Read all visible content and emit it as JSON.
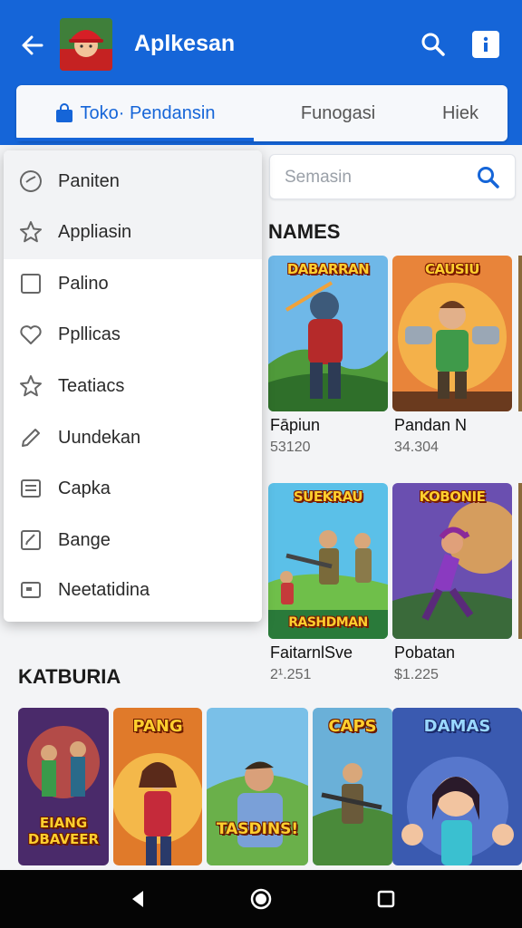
{
  "app_bar": {
    "title": "Aplkesan",
    "back_icon": "arrow-left-icon",
    "search_icon": "search-icon",
    "info_icon": "info-icon",
    "background": "#1565d8"
  },
  "tabs": [
    {
      "label": "Toko· Pendansin",
      "active": true,
      "icon": "shopping-bag-icon"
    },
    {
      "label": "Funogasi",
      "active": false
    },
    {
      "label": "Hiek",
      "active": false
    }
  ],
  "search": {
    "placeholder": "Semasin"
  },
  "menu": {
    "items": [
      {
        "label": "Paniten",
        "icon": "compass-badge-icon"
      },
      {
        "label": "Appliasin",
        "icon": "star-icon"
      },
      {
        "label": "Palino",
        "icon": "square-icon"
      },
      {
        "label": "Ppllicas",
        "icon": "heart-icon"
      },
      {
        "label": "Teatiacs",
        "icon": "star-icon"
      },
      {
        "label": "Uundekan",
        "icon": "pencil-icon"
      },
      {
        "label": "Capka",
        "icon": "document-icon"
      },
      {
        "label": "Bange",
        "icon": "edit-box-icon"
      },
      {
        "label": "Neetatidina",
        "icon": "card-icon"
      }
    ]
  },
  "names_section": {
    "title": "NAMES",
    "games": [
      {
        "logo": "DABARRAN",
        "name": "Fāpiun",
        "count": "53120"
      },
      {
        "logo": "CAUSIU",
        "name": "Pandan N",
        "count": "34.304"
      },
      {
        "logo": "SUEKRAU",
        "logo_bottom": "RASHDMAN",
        "name": "FaitarnlSve",
        "count": "2¹.251"
      },
      {
        "logo": "KOBONIE",
        "name": "Pobatan",
        "count": "$1.225"
      }
    ]
  },
  "categories_section": {
    "title": "KATBURIA",
    "tiles": [
      {
        "logo": "EIANG DBAVEER"
      },
      {
        "logo": "PANG"
      },
      {
        "logo": "TASDINS!"
      },
      {
        "logo": "CAPS"
      },
      {
        "logo": "DAMAS"
      }
    ]
  },
  "nav_bar": {
    "back": "triangle-back-icon",
    "home": "circle-home-icon",
    "recents": "square-recents-icon"
  }
}
